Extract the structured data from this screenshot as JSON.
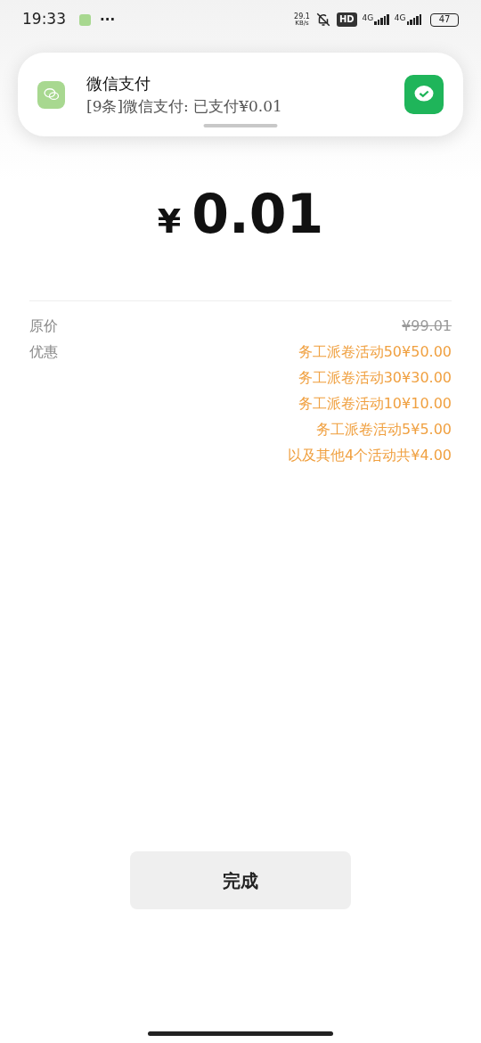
{
  "status_bar": {
    "time": "19:33",
    "more": "···",
    "speed_value": "29.1",
    "speed_unit": "KB/s",
    "hd_badge": "HD",
    "network_1": "4G",
    "network_2": "4G",
    "battery": "47"
  },
  "notification": {
    "title": "微信支付",
    "body": "[9条]微信支付: 已支付¥0.01"
  },
  "payment": {
    "currency": "¥",
    "amount": "0.01"
  },
  "details": [
    {
      "label": "原价",
      "values": [
        {
          "text": "¥99.01",
          "kind": "strikethrough"
        }
      ]
    },
    {
      "label": "优惠",
      "values": [
        {
          "text": "务工派卷活动50¥50.00",
          "kind": "discount"
        },
        {
          "text": "务工派卷活动30¥30.00",
          "kind": "discount"
        },
        {
          "text": "务工派卷活动10¥10.00",
          "kind": "discount"
        },
        {
          "text": "务工派卷活动5¥5.00",
          "kind": "discount"
        },
        {
          "text": "以及其他4个活动共¥4.00",
          "kind": "discount"
        }
      ]
    }
  ],
  "done_button": "完成"
}
